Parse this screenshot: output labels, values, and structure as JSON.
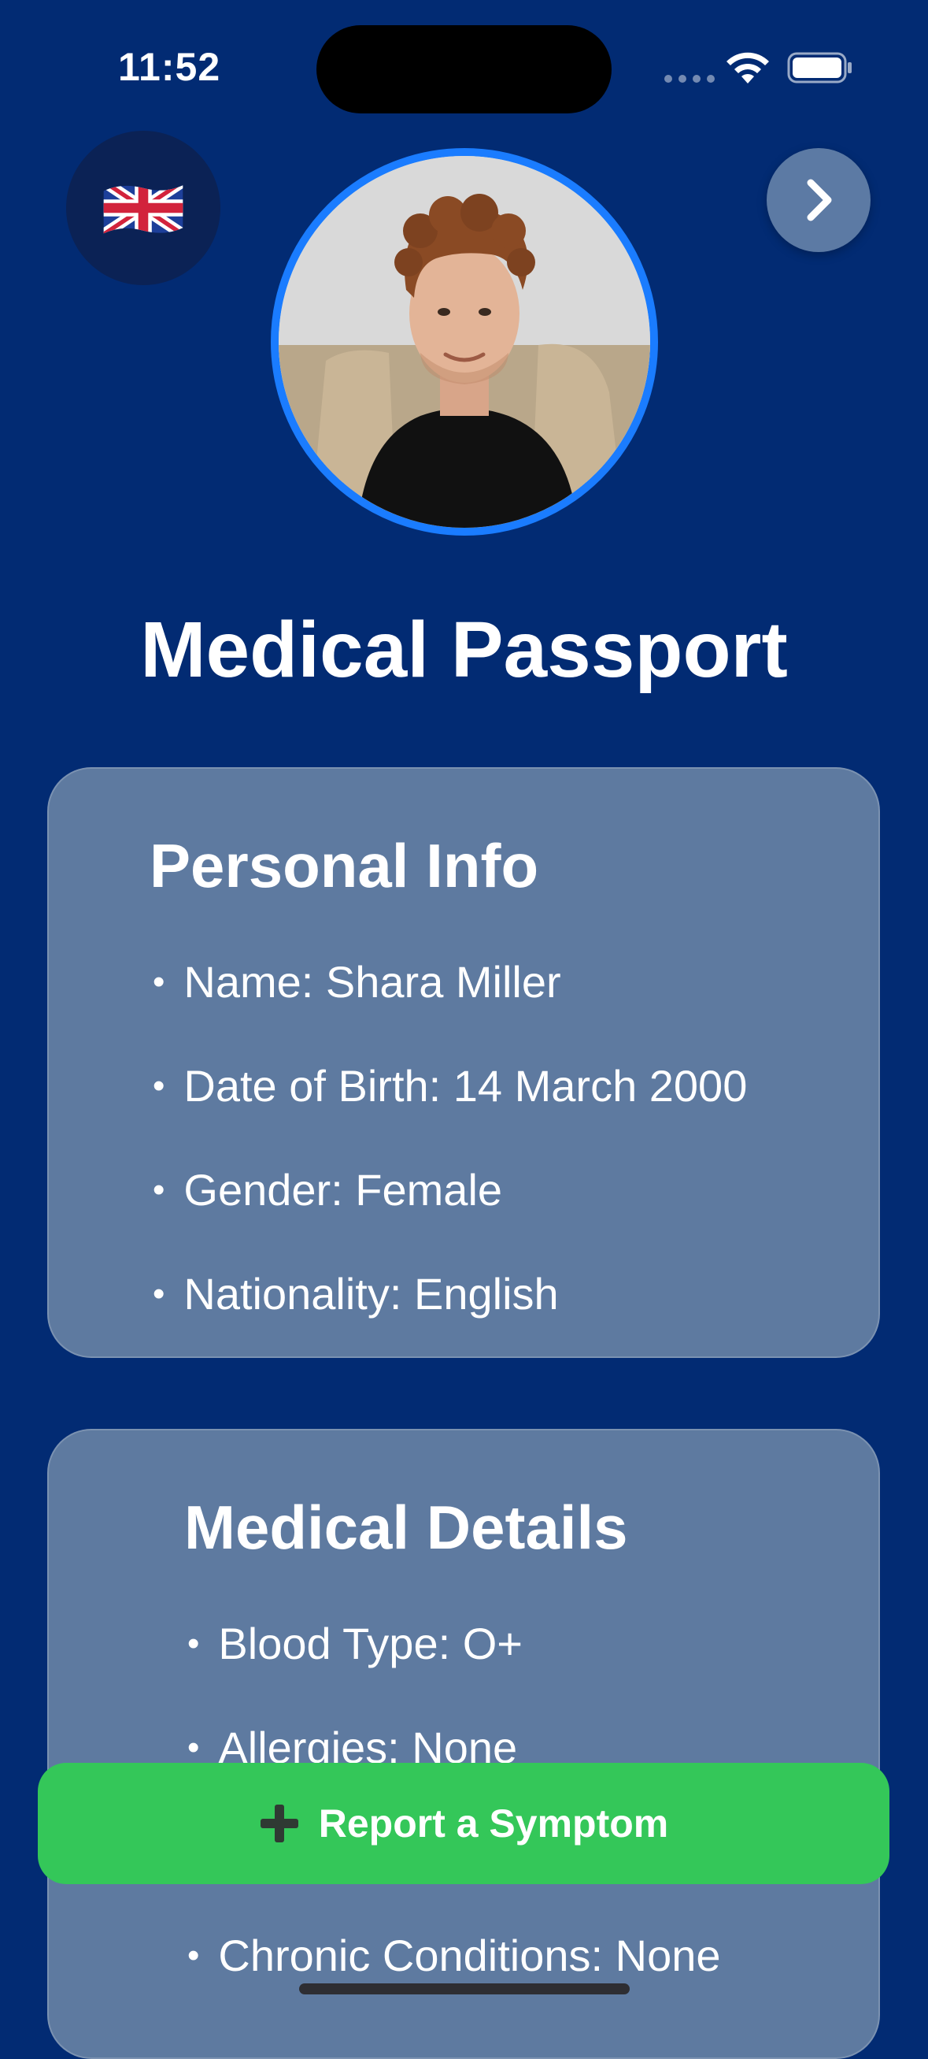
{
  "status_bar": {
    "time": "11:52"
  },
  "icons": {
    "flag": "uk-flag-icon",
    "next": "chevron-right-icon",
    "wifi": "wifi-icon",
    "battery": "battery-icon",
    "plus": "plus-icon"
  },
  "title": "Medical Passport",
  "personal_info": {
    "heading": "Personal Info",
    "items": [
      "Name: Shara Miller",
      "Date of Birth: 14 March 2000",
      "Gender: Female",
      "Nationality: English"
    ]
  },
  "medical_details": {
    "heading": "Medical Details",
    "items": [
      "Blood Type: O+",
      "Allergies: None",
      "Chronic Conditions: None"
    ]
  },
  "report_button": {
    "label": "Report a Symptom"
  },
  "colors": {
    "background": "#022b73",
    "card": "#5e7aa0",
    "accent_ring": "#1a7cff",
    "report_green": "#34c759"
  }
}
